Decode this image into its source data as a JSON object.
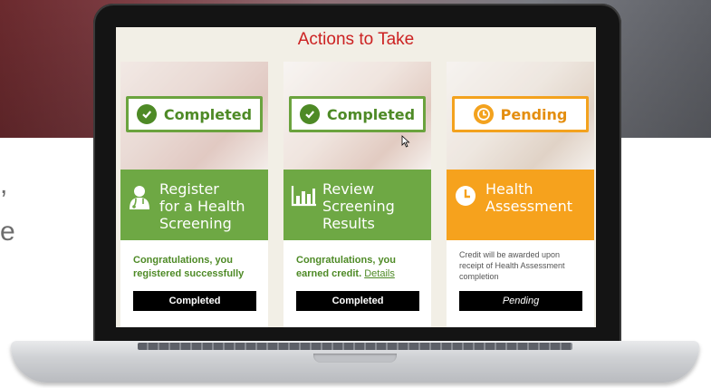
{
  "side_text": [
    ",",
    "e"
  ],
  "screen": {
    "title": "Actions to Take",
    "cards": [
      {
        "status": "Completed",
        "status_icon": "check-circle-icon",
        "banner_icon": "doctor-icon",
        "banner_title": "Register\nfor a Health\nScreening",
        "message": "Congratulations, you registered successfully",
        "button": "Completed"
      },
      {
        "status": "Completed",
        "status_icon": "check-circle-icon",
        "banner_icon": "bar-chart-icon",
        "banner_title": "Review\nScreening\nResults",
        "message": "Congratulations, you earned credit.",
        "link": "Details",
        "button": "Completed"
      },
      {
        "status": "Pending",
        "status_icon": "clock-icon",
        "banner_icon": "clock-icon",
        "banner_title": "Health\nAssessment",
        "message": "Credit will be awarded upon receipt of Health Assessment completion",
        "button": "Pending"
      }
    ]
  },
  "colors": {
    "title_red": "#cc2222",
    "green": "#6ea844",
    "green_dark": "#4e8a26",
    "orange": "#f6a21d",
    "button_black": "#000000"
  }
}
